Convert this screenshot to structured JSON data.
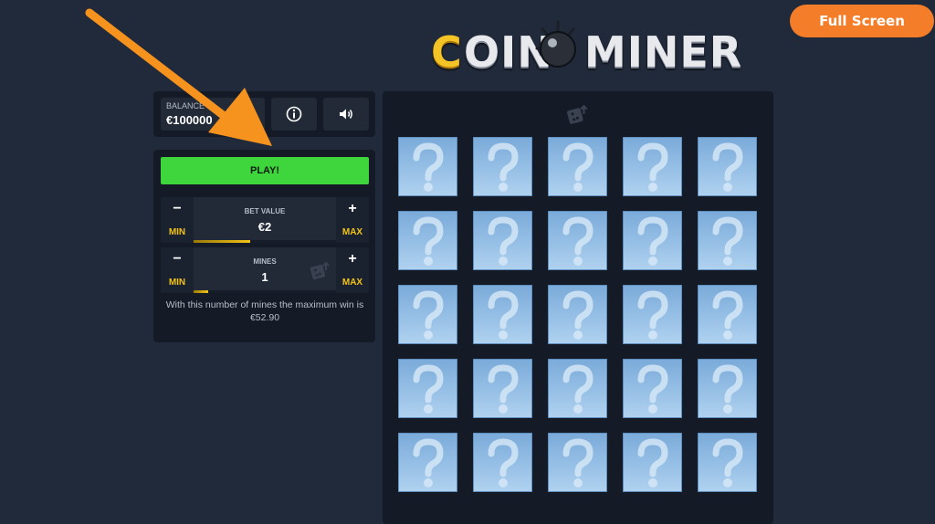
{
  "header": {
    "fullscreen_label": "Full Screen",
    "logo": {
      "coin_letter": "C",
      "coin_rest": "OIN",
      "miner": "MINER"
    }
  },
  "balance": {
    "label": "BALANCE",
    "value": "€100000"
  },
  "controls": {
    "play_label": "PLAY!",
    "bet": {
      "title": "BET VALUE",
      "value": "€2",
      "minus": "−",
      "plus": "+",
      "min_label": "MIN",
      "max_label": "MAX",
      "level": 0.4
    },
    "mines": {
      "title": "MINES",
      "value": "1",
      "minus": "−",
      "plus": "+",
      "min_label": "MIN",
      "max_label": "MAX",
      "level": 0.1
    },
    "info": "With this number of mines the maximum win is €52.90"
  },
  "board": {
    "rows": 5,
    "cols": 5,
    "tile_icon": "question-mark-icon"
  },
  "colors": {
    "accent_orange": "#f47d2a",
    "play_green": "#3ed63c",
    "gold": "#f3c316",
    "tile_blue": "#97c0e6"
  }
}
